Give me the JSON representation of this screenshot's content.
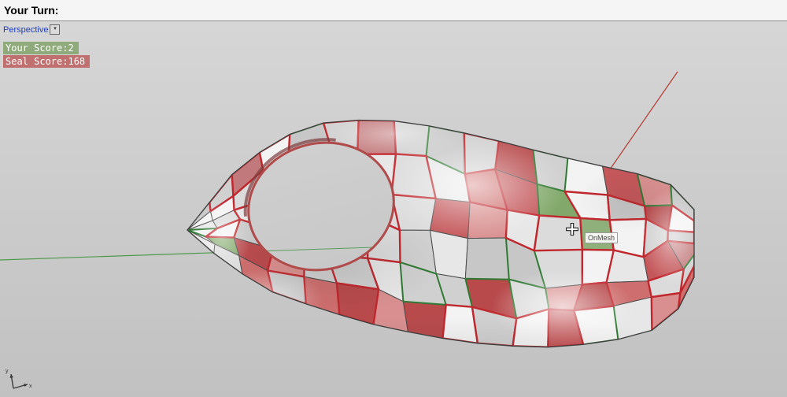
{
  "command_bar": {
    "prompt": "Your Turn:"
  },
  "viewport": {
    "label": "Perspective",
    "tab_caret": "▾"
  },
  "hud": {
    "your_score_label": "Your Score:",
    "your_score_value": "2",
    "your_score_bg": "#8fab7c",
    "seal_score_label": "Seal Score:",
    "seal_score_value": "168",
    "seal_score_bg": "#c17070"
  },
  "tooltip": {
    "text": "OnMesh"
  },
  "axes": {
    "x_color": "#b5392f",
    "y_color": "#4e9a4e",
    "indicator_x_label": "x",
    "indicator_y_label": "y"
  },
  "mesh": {
    "background_top": "#d6d6d6",
    "background_bottom": "#c1c1c1",
    "face_colors_light": [
      "#f3f3f3",
      "#e7e7e7",
      "#dbdbdb",
      "#d0d0d0"
    ],
    "face_colors_red": [
      "#c4575a",
      "#ce6e6e",
      "#b84a4c",
      "#d98f8f",
      "#c2797b"
    ],
    "face_colors_green": [
      "#82a96b",
      "#8fb07a"
    ],
    "edge_color_neutral": "#4a4a4a",
    "edge_color_red": "#c0272d",
    "edge_color_green": "#2f7a33"
  }
}
